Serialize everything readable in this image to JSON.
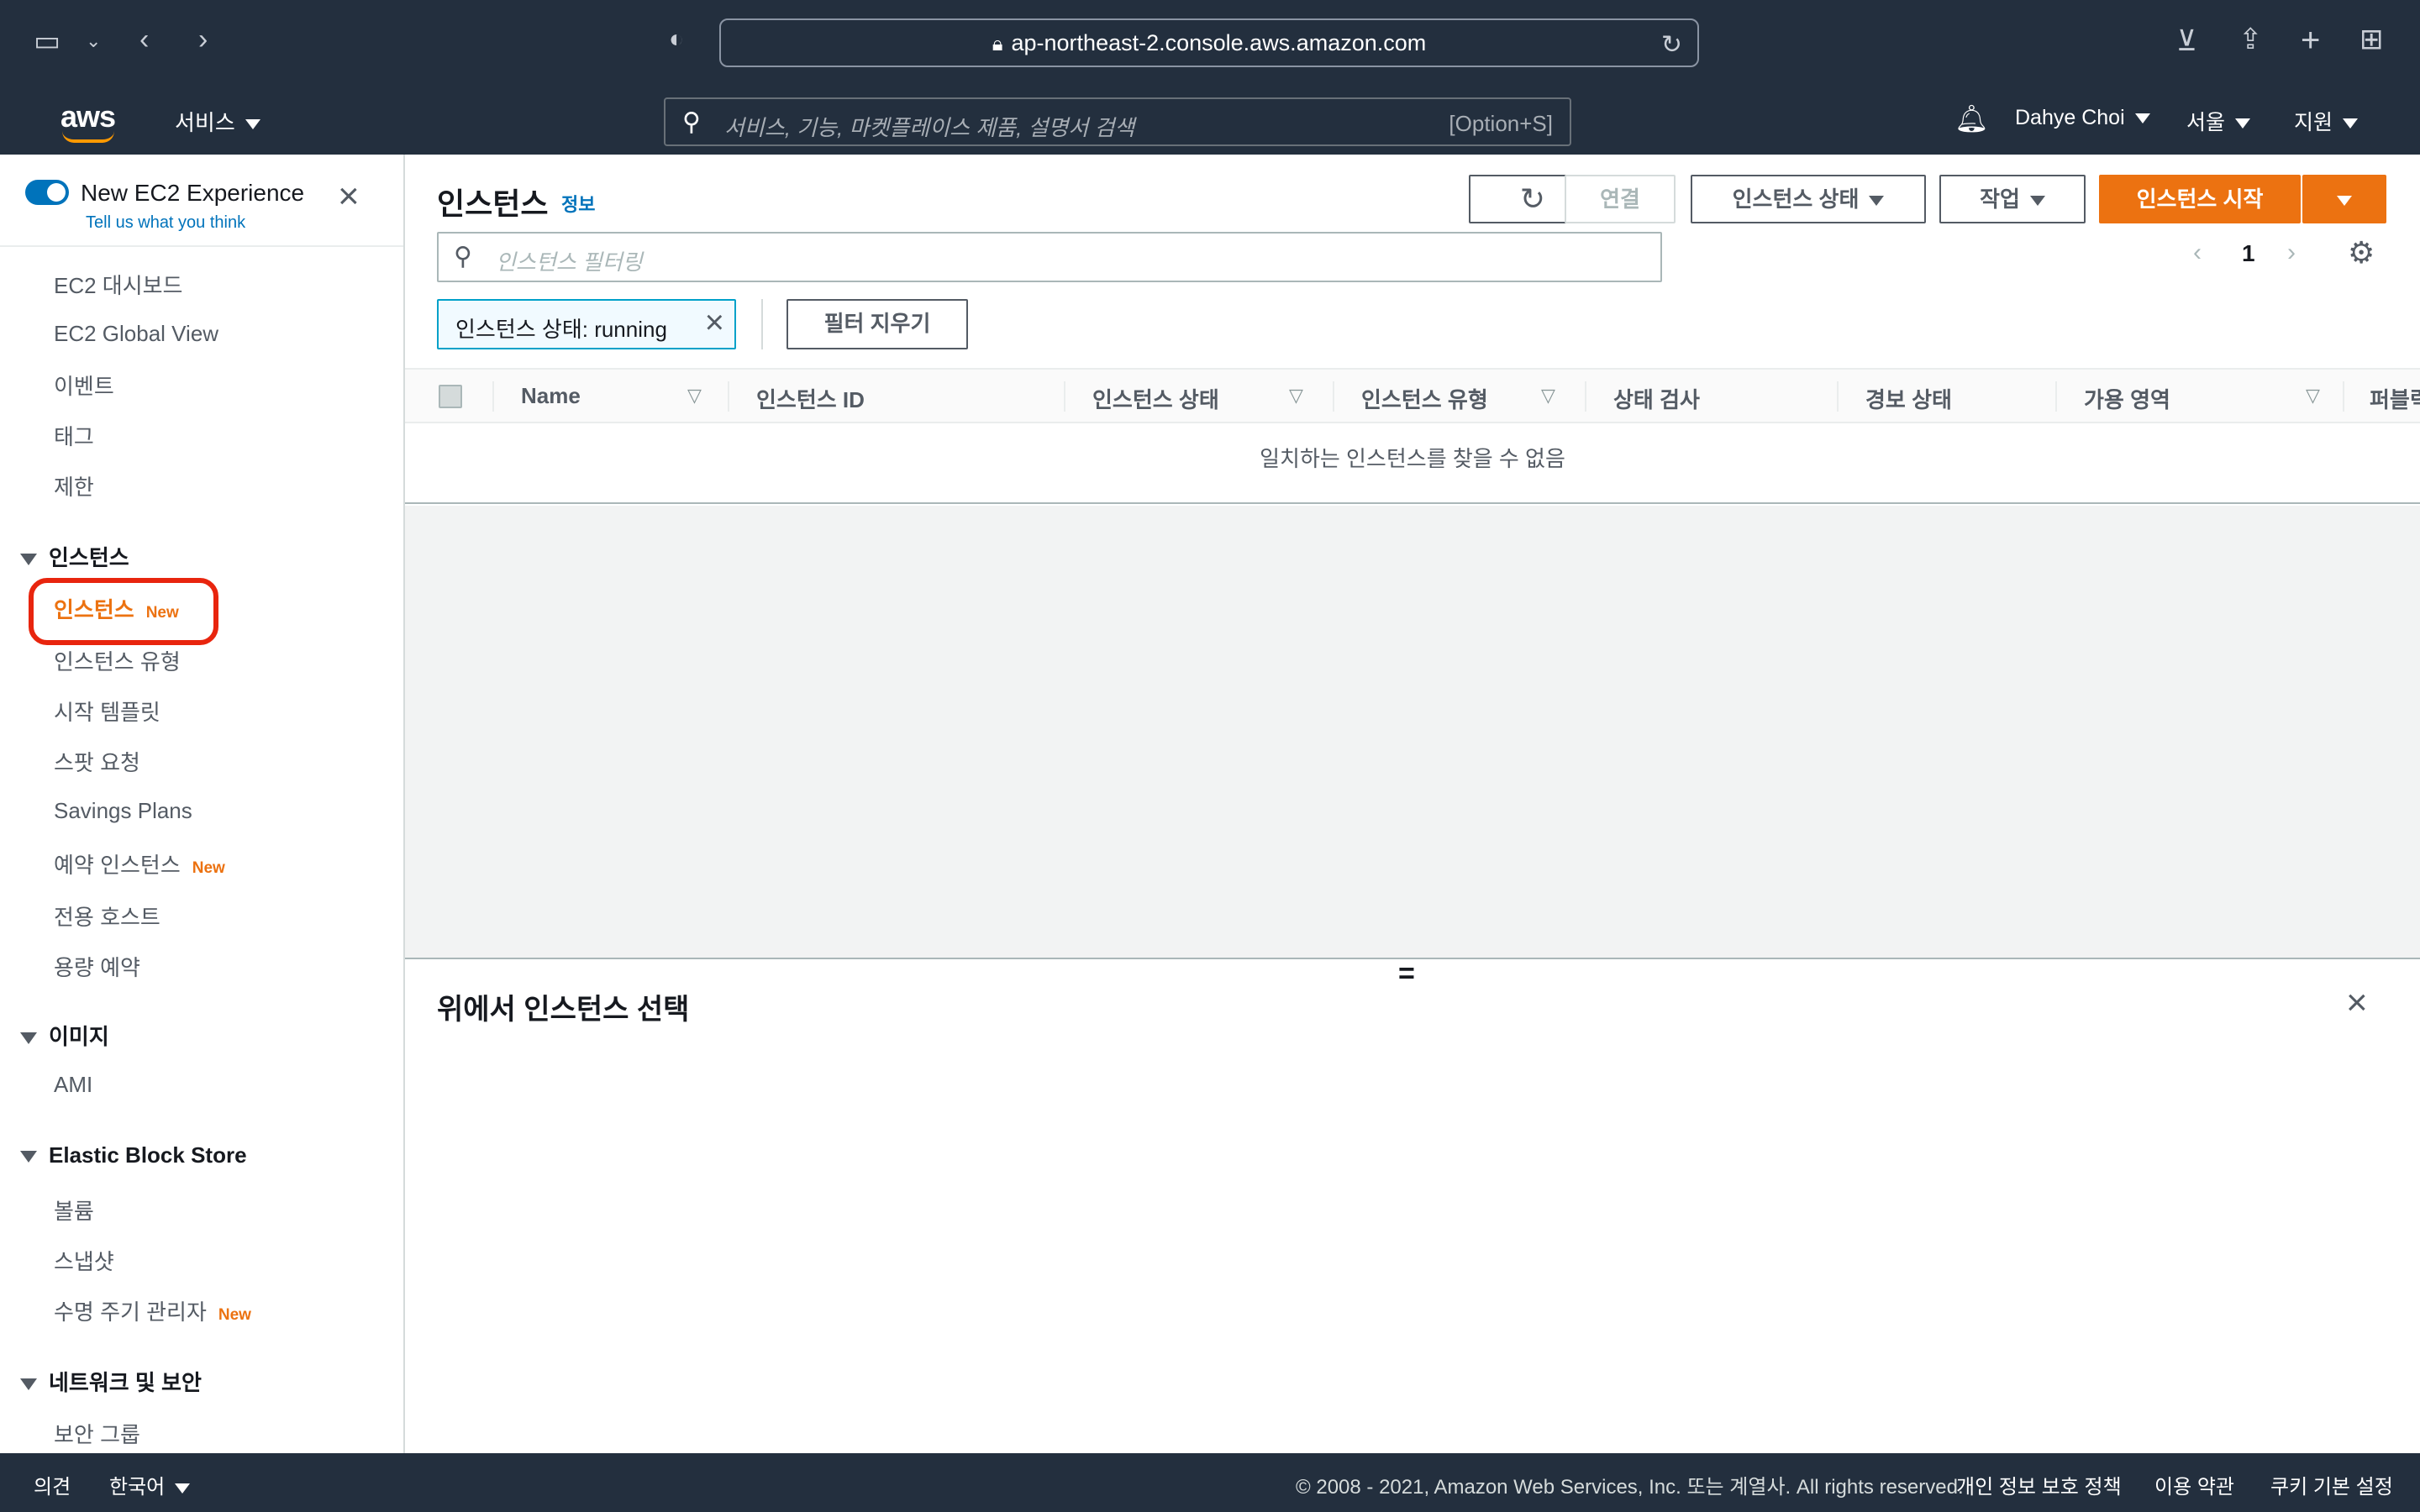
{
  "browser": {
    "url": "ap-northeast-2.console.aws.amazon.com"
  },
  "header": {
    "logo": "aws",
    "services": "서비스",
    "search_placeholder": "서비스, 기능, 마켓플레이스 제품, 설명서 검색",
    "search_shortcut": "[Option+S]",
    "user": "Dahye Choi",
    "region": "서울",
    "support": "지원"
  },
  "sidebar": {
    "experience_title": "New EC2 Experience",
    "experience_link": "Tell us what you think",
    "items": {
      "dashboard": "EC2 대시보드",
      "global_view": "EC2 Global View",
      "events": "이벤트",
      "tags": "태그",
      "limits": "제한",
      "section_instances": "인스턴스",
      "instances": "인스턴스",
      "instances_badge": "New",
      "instance_types": "인스턴스 유형",
      "launch_templates": "시작 템플릿",
      "spot_requests": "스팟 요청",
      "savings_plans": "Savings Plans",
      "reserved_instances": "예약 인스턴스",
      "reserved_badge": "New",
      "dedicated_hosts": "전용 호스트",
      "capacity_reservations": "용량 예약",
      "section_images": "이미지",
      "ami": "AMI",
      "section_ebs": "Elastic Block Store",
      "volumes": "볼륨",
      "snapshots": "스냅샷",
      "lifecycle_manager": "수명 주기 관리자",
      "lifecycle_badge": "New",
      "section_network": "네트워크 및 보안",
      "security_groups": "보안 그룹"
    }
  },
  "main": {
    "title": "인스턴스",
    "info": "정보",
    "connect": "연결",
    "instance_state": "인스턴스 상태",
    "actions": "작업",
    "launch": "인스턴스 시작",
    "filter_placeholder": "인스턴스 필터링",
    "page": "1",
    "filter_token": "인스턴스 상태: running",
    "clear_filters": "필터 지우기",
    "columns": [
      "Name",
      "인스턴스 ID",
      "인스턴스 상태",
      "인스턴스 유형",
      "상태 검사",
      "경보 상태",
      "가용 영역",
      "퍼블릭"
    ],
    "empty_message": "일치하는 인스턴스를 찾을 수 없음",
    "detail_title": "위에서 인스턴스 선택"
  },
  "footer": {
    "feedback": "의견",
    "language": "한국어",
    "copyright": "© 2008 - 2021, Amazon Web Services, Inc. 또는 계열사. All rights reserved.",
    "privacy": "개인 정보 보호 정책",
    "terms": "이용 약관",
    "cookies": "쿠키 기본 설정"
  },
  "colors": {
    "nav_bg": "#232f3e",
    "accent_orange": "#ec7211",
    "link_blue": "#0073bb",
    "highlight_red": "#e8250e"
  }
}
